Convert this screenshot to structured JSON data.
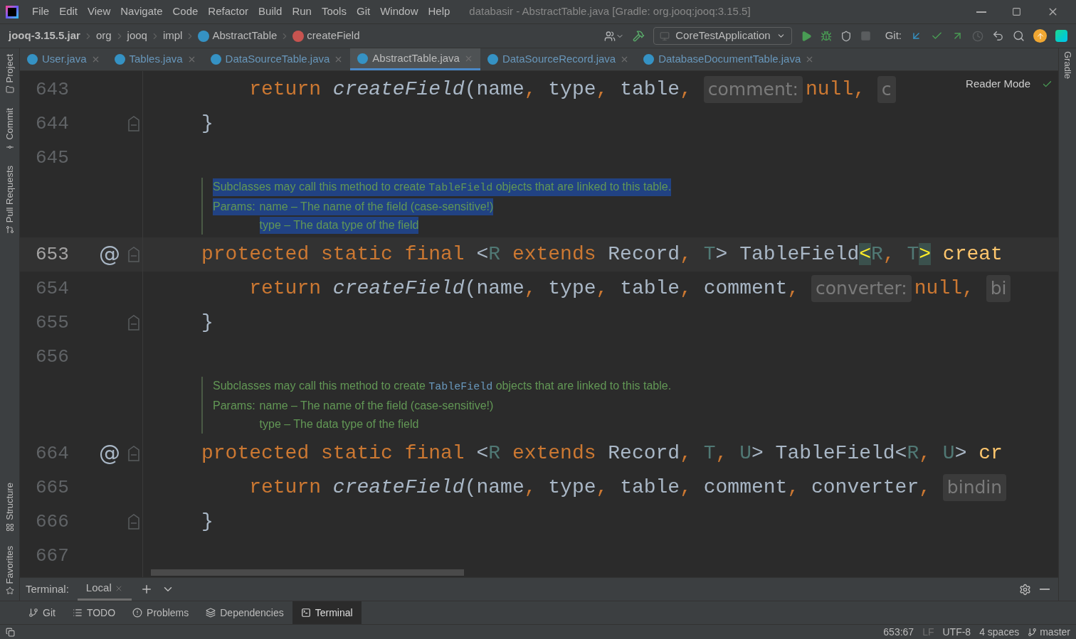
{
  "window": {
    "title": "databasir - AbstractTable.java [Gradle: org.jooq:jooq:3.15.5]"
  },
  "menu": [
    "File",
    "Edit",
    "View",
    "Navigate",
    "Code",
    "Refactor",
    "Build",
    "Run",
    "Tools",
    "Git",
    "Window",
    "Help"
  ],
  "breadcrumbs": [
    {
      "label": "jooq-3.15.5.jar",
      "kind": "jar"
    },
    {
      "label": "org",
      "kind": "package"
    },
    {
      "label": "jooq",
      "kind": "package"
    },
    {
      "label": "impl",
      "kind": "package"
    },
    {
      "label": "AbstractTable",
      "kind": "class"
    },
    {
      "label": "createField",
      "kind": "method"
    }
  ],
  "toolbar": {
    "run_config": "CoreTestApplication",
    "git_label": "Git:",
    "stop_disabled": true,
    "history_disabled": true
  },
  "tabs": [
    {
      "label": "User.java",
      "selected": false
    },
    {
      "label": "Tables.java",
      "selected": false
    },
    {
      "label": "DataSourceTable.java",
      "selected": false
    },
    {
      "label": "AbstractTable.java",
      "selected": true
    },
    {
      "label": "DataSourceRecord.java",
      "selected": false
    },
    {
      "label": "DatabaseDocumentTable.java",
      "selected": false
    }
  ],
  "left_tools": {
    "top": [
      "Project",
      "Commit",
      "Pull Requests"
    ],
    "bottom": [
      "Structure",
      "Favorites"
    ]
  },
  "right_tools": [
    "Gradle"
  ],
  "reader_mode": "Reader Mode",
  "editor": {
    "blocks": [
      {
        "kind": "code",
        "number": "643",
        "current": false,
        "fold": false,
        "tokens": [
          {
            "t": "    return ",
            "kind": "kw"
          },
          {
            "t": "createField",
            "kind": "call"
          },
          {
            "t": "(name",
            "kind": "plain"
          },
          {
            "t": ", ",
            "kind": "punct"
          },
          {
            "t": "type",
            "kind": "plain"
          },
          {
            "t": ", ",
            "kind": "punct"
          },
          {
            "t": "table",
            "kind": "plain"
          },
          {
            "t": ", ",
            "kind": "punct"
          },
          {
            "t": "comment:",
            "kind": "hint"
          },
          {
            "t": "null",
            "kind": "kw"
          },
          {
            "t": ", ",
            "kind": "punct"
          },
          {
            "t": "c",
            "kind": "hint"
          }
        ]
      },
      {
        "kind": "code",
        "number": "644",
        "current": false,
        "fold": true,
        "tokens": [
          {
            "t": "}",
            "kind": "plain"
          }
        ]
      },
      {
        "kind": "code",
        "number": "645",
        "current": false,
        "fold": false
      },
      {
        "kind": "doc",
        "selected": true,
        "summary": [
          {
            "t": "Subclasses may call this method to create ",
            "kind": "text"
          },
          {
            "t": "TableField",
            "kind": "code"
          },
          {
            "t": " objects that are linked to this table.",
            "kind": "text"
          }
        ],
        "params_label": "Params:",
        "params": [
          "name – The name of the field (case-sensitive!)",
          "type – The data type of the field"
        ]
      },
      {
        "kind": "code",
        "number": "653",
        "current": true,
        "fold": true,
        "marker": "@",
        "tokens": [
          {
            "t": "protected static final ",
            "kind": "kw"
          },
          {
            "t": "<",
            "kind": "plain"
          },
          {
            "t": "R ",
            "kind": "tparam"
          },
          {
            "t": "extends ",
            "kind": "kw"
          },
          {
            "t": "Record",
            "kind": "plain"
          },
          {
            "t": ", ",
            "kind": "punct"
          },
          {
            "t": "T",
            "kind": "tparam"
          },
          {
            "t": "> TableField",
            "kind": "plain"
          },
          {
            "t": "<",
            "kind": "match"
          },
          {
            "t": "R",
            "kind": "tparam"
          },
          {
            "t": ", ",
            "kind": "punct"
          },
          {
            "t": "T",
            "kind": "tparam"
          },
          {
            "t": ">",
            "kind": "match"
          },
          {
            "t": " creat",
            "kind": "decl"
          }
        ]
      },
      {
        "kind": "code",
        "number": "654",
        "current": false,
        "fold": false,
        "tokens": [
          {
            "t": "    return ",
            "kind": "kw"
          },
          {
            "t": "createField",
            "kind": "call"
          },
          {
            "t": "(name",
            "kind": "plain"
          },
          {
            "t": ", ",
            "kind": "punct"
          },
          {
            "t": "type",
            "kind": "plain"
          },
          {
            "t": ", ",
            "kind": "punct"
          },
          {
            "t": "table",
            "kind": "plain"
          },
          {
            "t": ", ",
            "kind": "punct"
          },
          {
            "t": "comment",
            "kind": "plain"
          },
          {
            "t": ", ",
            "kind": "punct"
          },
          {
            "t": "converter:",
            "kind": "hint"
          },
          {
            "t": "null",
            "kind": "kw"
          },
          {
            "t": ", ",
            "kind": "punct"
          },
          {
            "t": "bi",
            "kind": "hint"
          }
        ]
      },
      {
        "kind": "code",
        "number": "655",
        "current": false,
        "fold": true,
        "tokens": [
          {
            "t": "}",
            "kind": "plain"
          }
        ]
      },
      {
        "kind": "code",
        "number": "656",
        "current": false,
        "fold": false
      },
      {
        "kind": "doc",
        "selected": false,
        "summary": [
          {
            "t": "Subclasses may call this method to create ",
            "kind": "text"
          },
          {
            "t": "TableField",
            "kind": "code"
          },
          {
            "t": " objects that are linked to this table.",
            "kind": "text"
          }
        ],
        "params_label": "Params:",
        "params": [
          "name – The name of the field (case-sensitive!)",
          "type – The data type of the field"
        ]
      },
      {
        "kind": "code",
        "number": "664",
        "current": false,
        "fold": true,
        "marker": "@",
        "tokens": [
          {
            "t": "protected static final ",
            "kind": "kw"
          },
          {
            "t": "<",
            "kind": "plain"
          },
          {
            "t": "R ",
            "kind": "tparam"
          },
          {
            "t": "extends ",
            "kind": "kw"
          },
          {
            "t": "Record",
            "kind": "plain"
          },
          {
            "t": ", ",
            "kind": "punct"
          },
          {
            "t": "T",
            "kind": "tparam"
          },
          {
            "t": ", ",
            "kind": "punct"
          },
          {
            "t": "U",
            "kind": "tparam"
          },
          {
            "t": "> TableField<",
            "kind": "plain"
          },
          {
            "t": "R",
            "kind": "tparam"
          },
          {
            "t": ", ",
            "kind": "punct"
          },
          {
            "t": "U",
            "kind": "tparam"
          },
          {
            "t": "> ",
            "kind": "plain"
          },
          {
            "t": "cr",
            "kind": "decl"
          }
        ]
      },
      {
        "kind": "code",
        "number": "665",
        "current": false,
        "fold": false,
        "tokens": [
          {
            "t": "    return ",
            "kind": "kw"
          },
          {
            "t": "createField",
            "kind": "call"
          },
          {
            "t": "(name",
            "kind": "plain"
          },
          {
            "t": ", ",
            "kind": "punct"
          },
          {
            "t": "type",
            "kind": "plain"
          },
          {
            "t": ", ",
            "kind": "punct"
          },
          {
            "t": "table",
            "kind": "plain"
          },
          {
            "t": ", ",
            "kind": "punct"
          },
          {
            "t": "comment",
            "kind": "plain"
          },
          {
            "t": ", ",
            "kind": "punct"
          },
          {
            "t": "converter",
            "kind": "plain"
          },
          {
            "t": ", ",
            "kind": "punct"
          },
          {
            "t": "bindin",
            "kind": "hint"
          }
        ]
      },
      {
        "kind": "code",
        "number": "666",
        "current": false,
        "fold": true,
        "tokens": [
          {
            "t": "}",
            "kind": "plain"
          }
        ]
      },
      {
        "kind": "code",
        "number": "667",
        "current": false,
        "fold": false
      }
    ]
  },
  "terminal": {
    "label": "Terminal:",
    "tabs": [
      {
        "label": "Local",
        "selected": true
      }
    ]
  },
  "tool_tabs": [
    {
      "label": "Git",
      "kind": "git",
      "selected": false
    },
    {
      "label": "TODO",
      "kind": "todo",
      "selected": false
    },
    {
      "label": "Problems",
      "kind": "problems",
      "selected": false
    },
    {
      "label": "Dependencies",
      "kind": "deps",
      "selected": false
    },
    {
      "label": "Terminal",
      "kind": "terminal",
      "selected": true
    }
  ],
  "status_bar": {
    "position": "653:67",
    "line_sep": "LF",
    "encoding": "UTF-8",
    "indent": "4 spaces",
    "branch": "master"
  }
}
